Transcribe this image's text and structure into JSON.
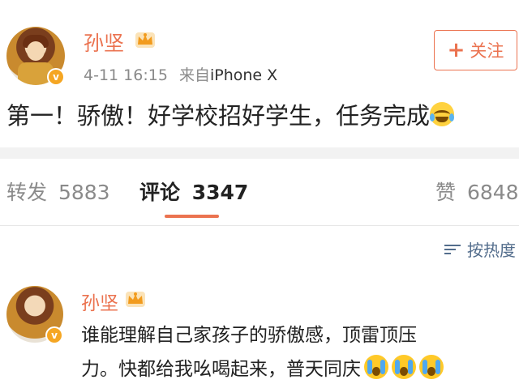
{
  "post": {
    "author": "孙坚",
    "time": "4-11 16:15",
    "source_prefix": "来自",
    "source": "iPhone X",
    "follow_label": "关注",
    "text": "第一！骄傲！好学校招好学生，任务完成",
    "emoji": "laugh-cry-emoji"
  },
  "tabs": {
    "repost_label": "转发",
    "repost_count": "5883",
    "comment_label": "评论",
    "comment_count": "3347",
    "like_label": "赞",
    "like_count": "6848"
  },
  "sort": {
    "label": "按热度"
  },
  "comment": {
    "author": "孙坚",
    "text_line1": "谁能理解自己家孩子的骄傲感，顶雷顶压",
    "text_line2": "力。快都给我吆喝起来，普天同庆",
    "emojis": [
      "crying-emoji",
      "crying-emoji",
      "crying-emoji"
    ]
  },
  "colors": {
    "accent": "#eb7350",
    "link": "#536d8c",
    "muted": "#8a8a8a",
    "badge": "#f5a623"
  }
}
